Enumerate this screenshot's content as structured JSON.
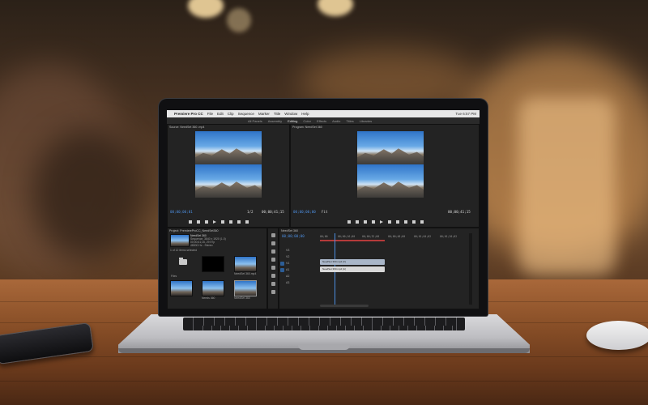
{
  "scene": {
    "description_items": [
      "laptop",
      "phone",
      "mouse",
      "table"
    ]
  },
  "app": {
    "menu": {
      "apple_glyph": "",
      "app_name": "Premiere Pro CC",
      "items": [
        "File",
        "Edit",
        "Clip",
        "Sequence",
        "Marker",
        "Title",
        "Window",
        "Help"
      ],
      "clock": "Tue 6:57 PM"
    },
    "workspaces": [
      "All Panels",
      "Assembly",
      "Editing",
      "Color",
      "Effects",
      "Audio",
      "Titles",
      "Libraries"
    ],
    "active_workspace": "Editing",
    "source_monitor": {
      "title": "Source: NeedSet 360 .mp4",
      "timecode_left": "00;00;00;01",
      "timecode_right": "00;00;41;15",
      "fit": "1/2"
    },
    "program_monitor": {
      "title": "Program: NeedSet 360",
      "timecode_left": "00;00;00;00",
      "timecode_right": "00;00;41;15",
      "fit": "Fit"
    },
    "project_panel": {
      "title": "Project: PremiereProCC_NeedSet360",
      "tabs": [
        "Project",
        "Libraries",
        "Info"
      ],
      "clip_name": "NeedSet 360",
      "clip_meta": "Sequence, 3840 x 1920 (1.0)",
      "clip_duration": "00;00;41;15, 29.97p",
      "clip_audio": "48000 Hz - Stereo",
      "item_count": "1 of 12 items selected",
      "bins": [
        {
          "label": "Files",
          "type": "folder"
        },
        {
          "label": "",
          "type": "black"
        },
        {
          "label": "NeedSet 360.mp4",
          "type": "thumb"
        },
        {
          "label": "",
          "type": "thumb"
        },
        {
          "label": "Needs 360",
          "type": "thumb"
        },
        {
          "label": "",
          "type": "thumb"
        },
        {
          "label": "NeedSet 360",
          "type": "thumb"
        }
      ]
    },
    "timeline": {
      "title": "NeedSet 360",
      "timecode": "00;00;00;00",
      "ruler": [
        "00;00",
        "00;00;16;00",
        "00;00;32;00",
        "00;00;48;00",
        "00;01;04;02",
        "00;01;20;02"
      ],
      "tracks": [
        "V3",
        "V2",
        "V1",
        "A1",
        "A2",
        "A3"
      ],
      "video_clip": "NeedSet 360.mp4 [V]",
      "audio_clip": "NeedSet 360.mp4 [A]"
    }
  }
}
